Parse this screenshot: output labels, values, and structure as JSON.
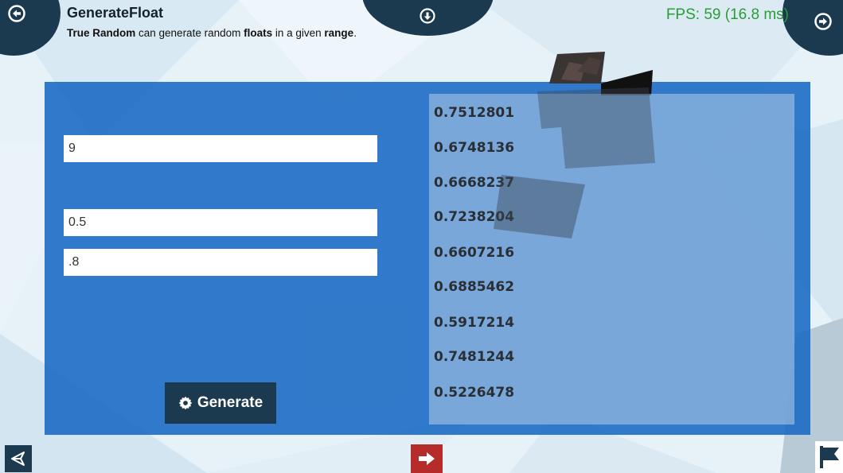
{
  "header": {
    "title": "GenerateFloat",
    "desc_part1": "True Random",
    "desc_part2": " can generate random ",
    "desc_part3": "floats",
    "desc_part4": " in a given ",
    "desc_part5": "range",
    "desc_part6": "."
  },
  "fps": "FPS: 59 (16.8 ms)",
  "inputs": {
    "count": "9",
    "min": "0.5",
    "max": ".8"
  },
  "generate_button": {
    "label": "Generate",
    "icon": "gear-icon"
  },
  "results": [
    "0.7512801",
    "0.6748136",
    "0.6668237",
    "0.7238204",
    "0.6607216",
    "0.6885462",
    "0.5917214",
    "0.7481244",
    "0.5226478"
  ],
  "icons": {
    "nav_left": "arrow-left-circle-icon",
    "nav_top": "arrow-down-circle-icon",
    "nav_right": "arrow-right-circle-icon",
    "footer_left": "unity-logo-icon",
    "footer_mid": "exit-icon",
    "footer_right": "flag-icon"
  },
  "colors": {
    "panel": "#1d6cc4",
    "nav": "#1b3a4f",
    "fps": "#2a9d34",
    "exit": "#b52c2a"
  }
}
